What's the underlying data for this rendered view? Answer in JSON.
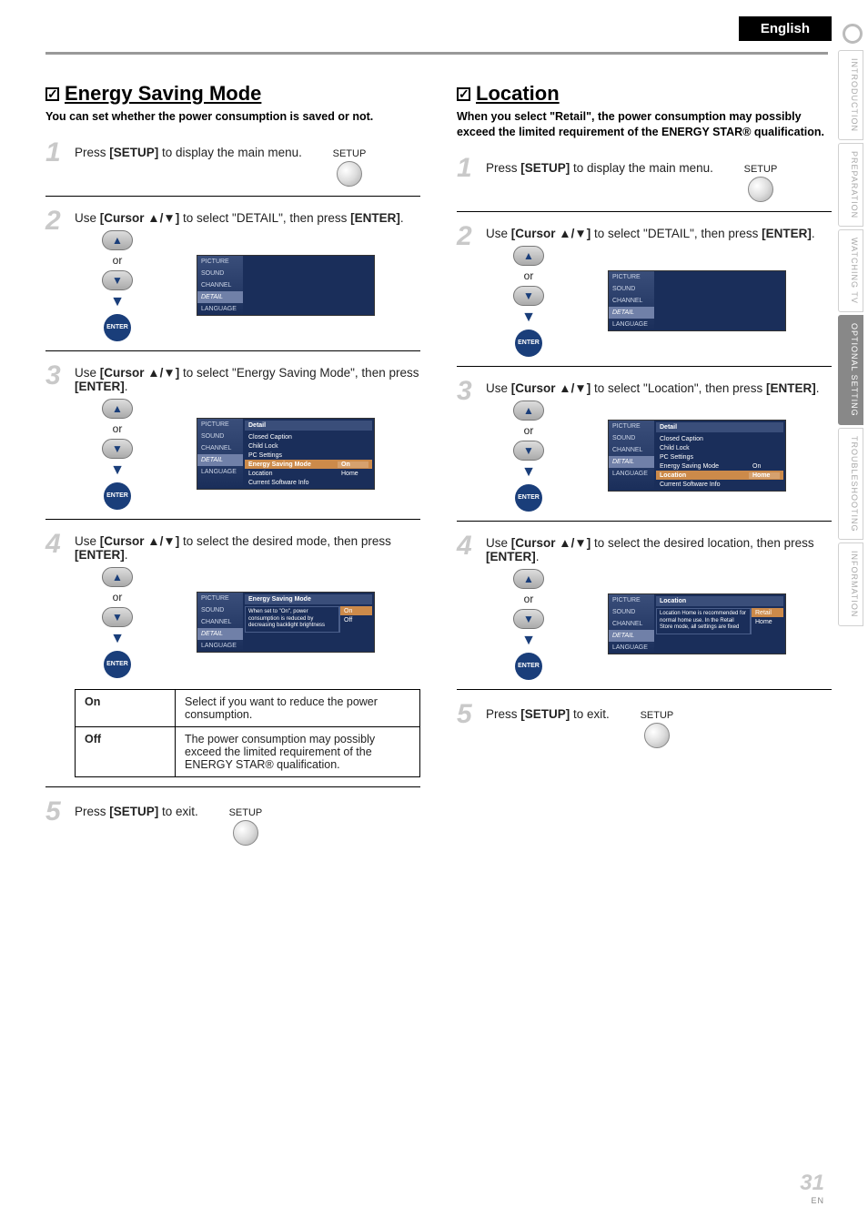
{
  "header": {
    "language": "English"
  },
  "side_tabs": [
    "INTRODUCTION",
    "PREPARATION",
    "WATCHING TV",
    "OPTIONAL SETTING",
    "TROUBLESHOOTING",
    "INFORMATION"
  ],
  "side_tabs_active_index": 3,
  "labels": {
    "setup": "SETUP",
    "or": "or",
    "enter": "ENTER",
    "checkmark": "✓"
  },
  "osd_side_items": [
    "PICTURE",
    "SOUND",
    "CHANNEL",
    "DETAIL",
    "LANGUAGE"
  ],
  "osd_detail": {
    "title": "Detail",
    "items": [
      "Closed Caption",
      "Child Lock",
      "PC Settings",
      "Energy Saving Mode",
      "Location",
      "Current Software Info"
    ],
    "vals": {
      "Energy Saving Mode": "On",
      "Location": "Home"
    }
  },
  "left": {
    "title": "Energy Saving Mode",
    "subtitle": "You can set whether the power consumption is saved or not.",
    "steps": {
      "s1": {
        "pre": "Press ",
        "b": "[SETUP]",
        "post": " to display the main menu."
      },
      "s2": {
        "pre": "Use ",
        "b": "[Cursor ▲/▼]",
        "mid": " to select \"DETAIL\", then press ",
        "b2": "[ENTER]",
        "post": "."
      },
      "s3": {
        "pre": "Use ",
        "b": "[Cursor ▲/▼]",
        "mid": " to select \"Energy Saving Mode\", then press ",
        "b2": "[ENTER]",
        "post": "."
      },
      "s4": {
        "pre": "Use ",
        "b": "[Cursor ▲/▼]",
        "mid": " to select the desired mode, then press ",
        "b2": "[ENTER]",
        "post": "."
      },
      "s5": {
        "pre": "Press ",
        "b": "[SETUP]",
        "post": " to exit."
      }
    },
    "osd4": {
      "title": "Energy Saving Mode",
      "desc": "When set to \"On\", power consumption is reduced by decreasing backlight brightness",
      "opts": [
        "On",
        "Off"
      ],
      "sel": "On"
    },
    "table": {
      "rows": [
        {
          "k": "On",
          "v": "Select if you want to reduce the power consumption."
        },
        {
          "k": "Off",
          "v": "The power consumption may possibly exceed the limited requirement of the ENERGY STAR® qualification."
        }
      ]
    }
  },
  "right": {
    "title": "Location",
    "subtitle": "When you select \"Retail\", the power consumption may possibly exceed the limited requirement of the ENERGY STAR® qualification.",
    "steps": {
      "s1": {
        "pre": "Press ",
        "b": "[SETUP]",
        "post": " to display the main menu."
      },
      "s2": {
        "pre": "Use ",
        "b": "[Cursor ▲/▼]",
        "mid": " to select \"DETAIL\", then press ",
        "b2": "[ENTER]",
        "post": "."
      },
      "s3": {
        "pre": "Use ",
        "b": "[Cursor ▲/▼]",
        "mid": " to select \"Location\", then press ",
        "b2": "[ENTER]",
        "post": "."
      },
      "s4": {
        "pre": "Use ",
        "b": "[Cursor ▲/▼]",
        "mid": " to select the desired location, then press ",
        "b2": "[ENTER]",
        "post": "."
      },
      "s5": {
        "pre": "Press ",
        "b": "[SETUP]",
        "post": " to exit."
      }
    },
    "osd4": {
      "title": "Location",
      "desc": "Location Home is recommended for normal home use. In the Retail Store mode, all settings are fixed",
      "opts": [
        "Retail",
        "Home"
      ],
      "sel": "Retail"
    }
  },
  "footer": {
    "page": "31",
    "code": "EN"
  }
}
